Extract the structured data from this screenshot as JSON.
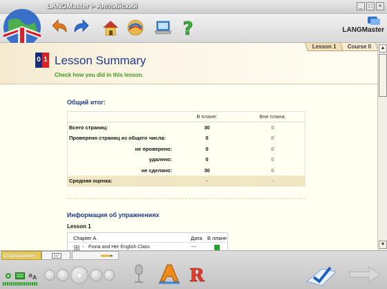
{
  "window": {
    "title": "LANGMaster > Английский",
    "controls": [
      "_",
      "□",
      "×"
    ]
  },
  "toolbar": {
    "buttons": [
      "back-icon",
      "forward-icon",
      "home-icon",
      "course-map-icon",
      "laptop-icon",
      "help-icon"
    ],
    "logo": "LANGMaster"
  },
  "header": {
    "tabs": [
      {
        "label": "Lesson 1",
        "active": true
      },
      {
        "label": "Course 0",
        "active": false
      }
    ],
    "badge": [
      "0",
      "1"
    ],
    "title": "Lesson Summary",
    "subtitle": "Check how you did in this lesson."
  },
  "summary": {
    "heading": "Общий итог:",
    "col_planned": "В плане:",
    "col_unplanned": "Вне плана:",
    "rows": [
      {
        "label": "Всего страниц:",
        "planned": "30",
        "unplanned": "0"
      },
      {
        "label": "Проверено страниц из общего числа:",
        "planned": "0",
        "unplanned": "0"
      },
      {
        "label": "не проверено:",
        "planned": "0",
        "unplanned": "0"
      },
      {
        "label": "удалено:",
        "planned": "0",
        "unplanned": "0"
      },
      {
        "label": "не сделано:",
        "planned": "30",
        "unplanned": "0"
      }
    ],
    "avg": {
      "label": "Средняя оценка:",
      "planned": "-",
      "unplanned": "-"
    }
  },
  "exercises": {
    "heading": "Информация об упражнениях",
    "lesson_label": "Lesson 1",
    "table_head": {
      "chapter": "Chapter A",
      "date": "Дата",
      "planned": "В плане"
    },
    "rows": [
      {
        "marker": "-",
        "title": "Fiona and Her English Class",
        "date": "---"
      }
    ]
  },
  "bottom": {
    "contents_tab": "Содержание"
  },
  "colors": {
    "title_blue": "#1e3a8a",
    "subtitle_green": "#3a9a1a",
    "avg_row": "#f1e7c5"
  }
}
